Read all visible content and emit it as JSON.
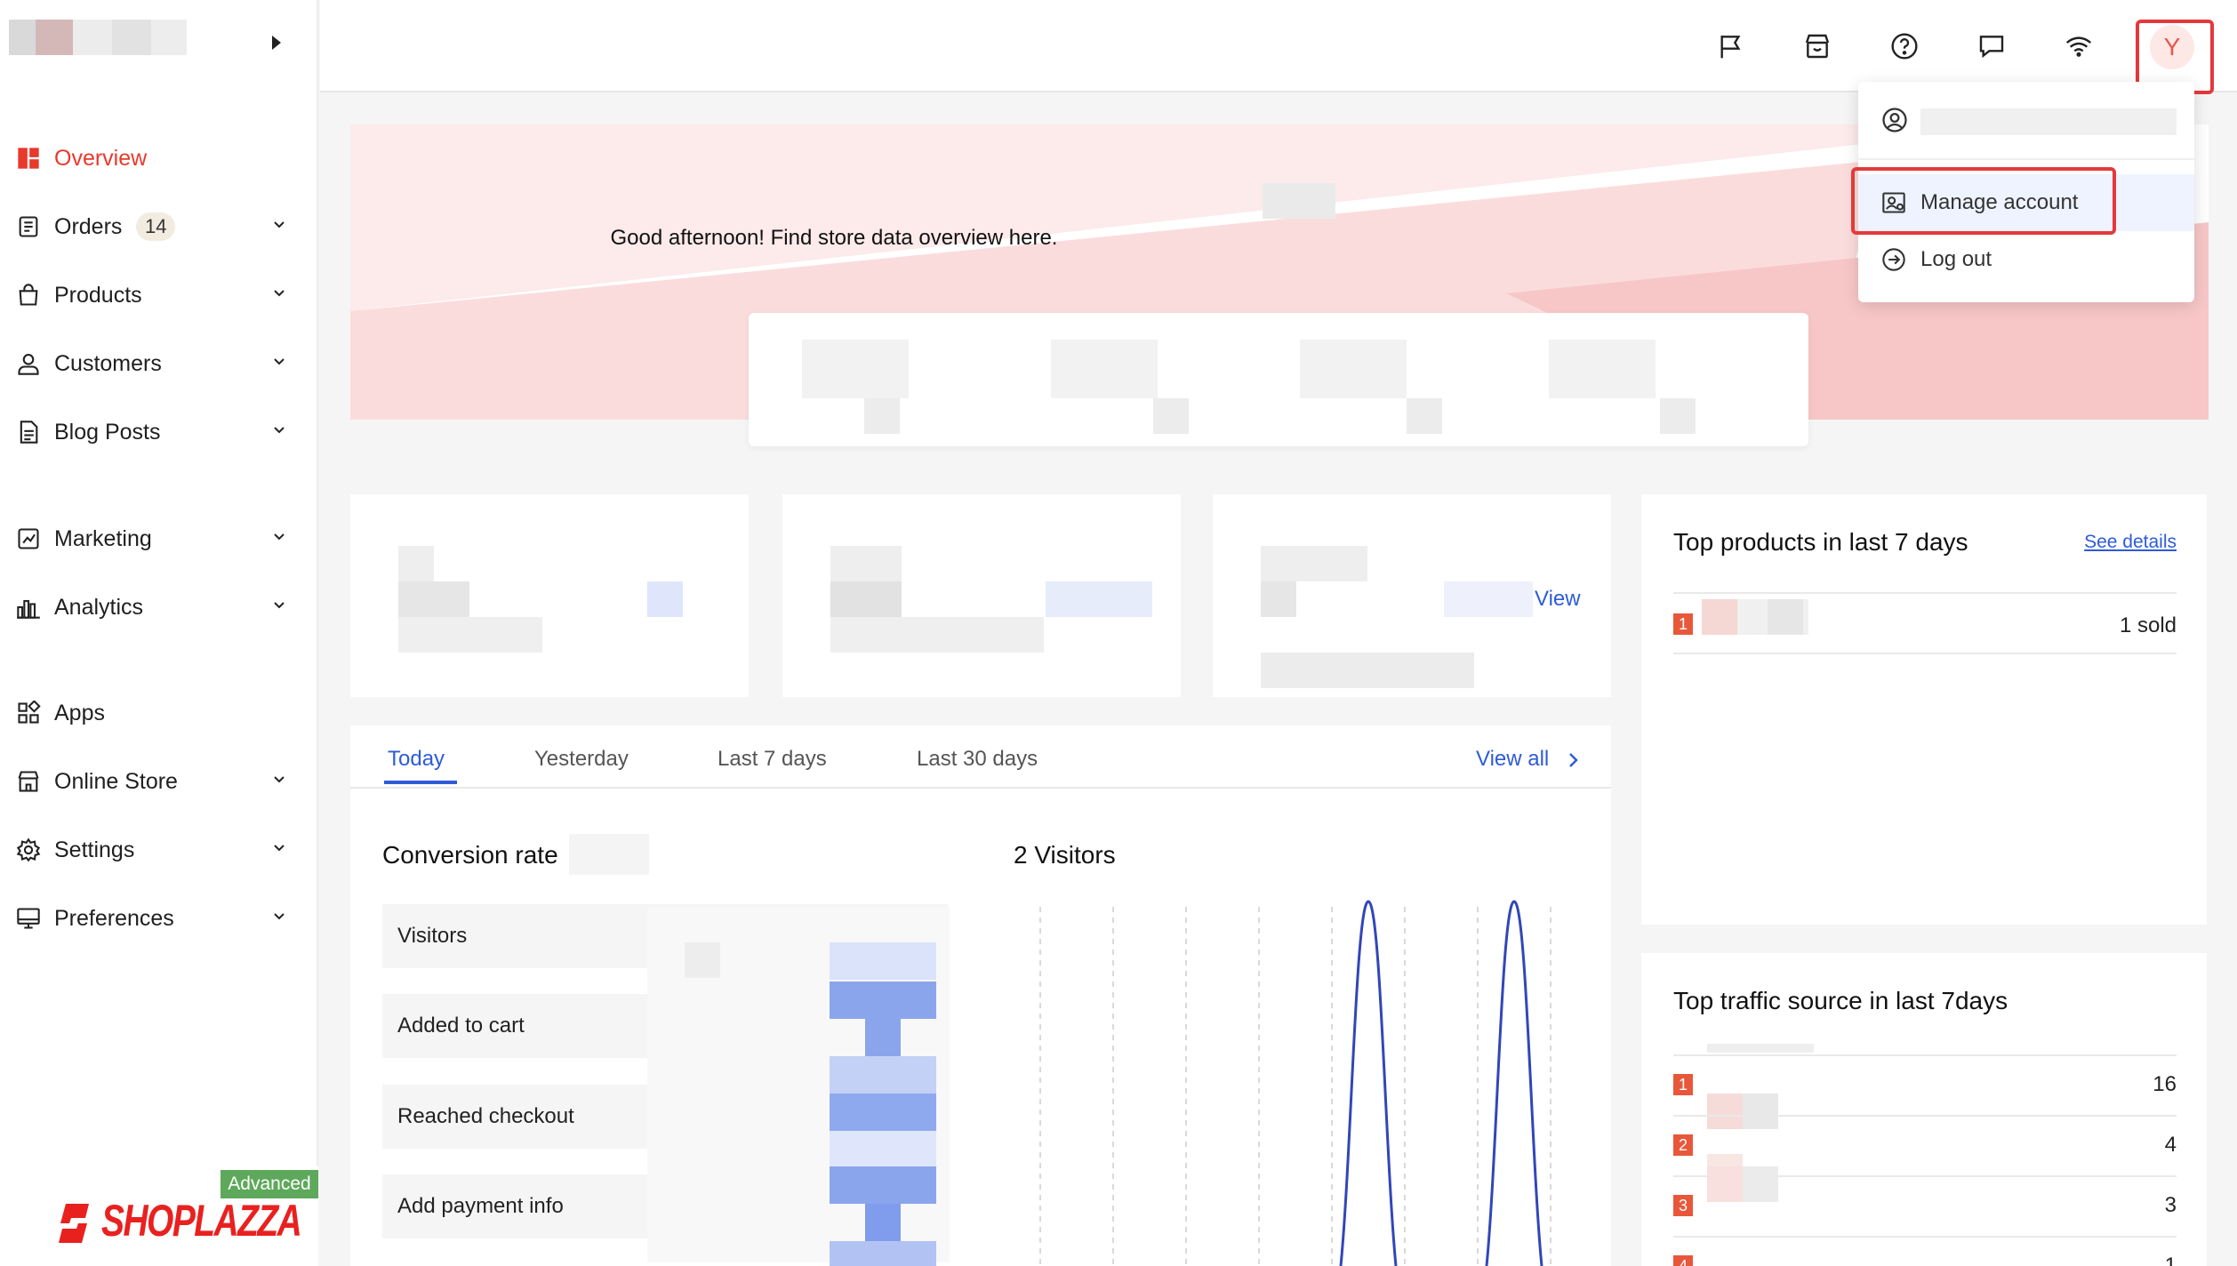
{
  "sidebar": {
    "items": [
      {
        "label": "Overview",
        "icon": "overview-icon"
      },
      {
        "label": "Orders",
        "icon": "orders-icon",
        "badge": "14"
      },
      {
        "label": "Products",
        "icon": "products-icon"
      },
      {
        "label": "Customers",
        "icon": "customers-icon"
      },
      {
        "label": "Blog Posts",
        "icon": "blog-icon"
      },
      {
        "label": "Marketing",
        "icon": "marketing-icon"
      },
      {
        "label": "Analytics",
        "icon": "analytics-icon"
      },
      {
        "label": "Apps",
        "icon": "apps-icon"
      },
      {
        "label": "Online Store",
        "icon": "store-icon"
      },
      {
        "label": "Settings",
        "icon": "settings-icon"
      },
      {
        "label": "Preferences",
        "icon": "preferences-icon"
      }
    ],
    "plan_badge": "Advanced",
    "brand_name": "SHOPLAZZA"
  },
  "topbar": {
    "avatar_letter": "Y",
    "icons": [
      "flag-icon",
      "storefront-icon",
      "help-icon",
      "chat-icon",
      "wifi-icon"
    ]
  },
  "user_menu": {
    "items": [
      {
        "label": "Manage account",
        "icon": "manage-account-icon"
      },
      {
        "label": "Log out",
        "icon": "logout-icon"
      }
    ]
  },
  "hero": {
    "greeting": "Good afternoon! Find store data overview here."
  },
  "stats": {
    "view_link": "View"
  },
  "tabs": {
    "items": [
      "Today",
      "Yesterday",
      "Last 7 days",
      "Last 30 days"
    ],
    "view_all": "View all"
  },
  "conversion": {
    "title": "Conversion rate",
    "funnel": [
      "Visitors",
      "Added to cart",
      "Reached checkout",
      "Add payment info"
    ]
  },
  "visitors": {
    "title": "2 Visitors"
  },
  "top_products": {
    "title": "Top products in last 7 days",
    "see_details": "See details",
    "rows": [
      {
        "rank": "1",
        "value": "1 sold"
      }
    ]
  },
  "top_traffic": {
    "title": "Top traffic source in last 7days",
    "rows": [
      {
        "rank": "1",
        "value": "16"
      },
      {
        "rank": "2",
        "value": "4"
      },
      {
        "rank": "3",
        "value": "3"
      },
      {
        "rank": "4",
        "value": "1"
      }
    ]
  },
  "colors": {
    "accent": "#e8392c",
    "link": "#2e5bd9",
    "highlight_box": "#e5383b"
  }
}
